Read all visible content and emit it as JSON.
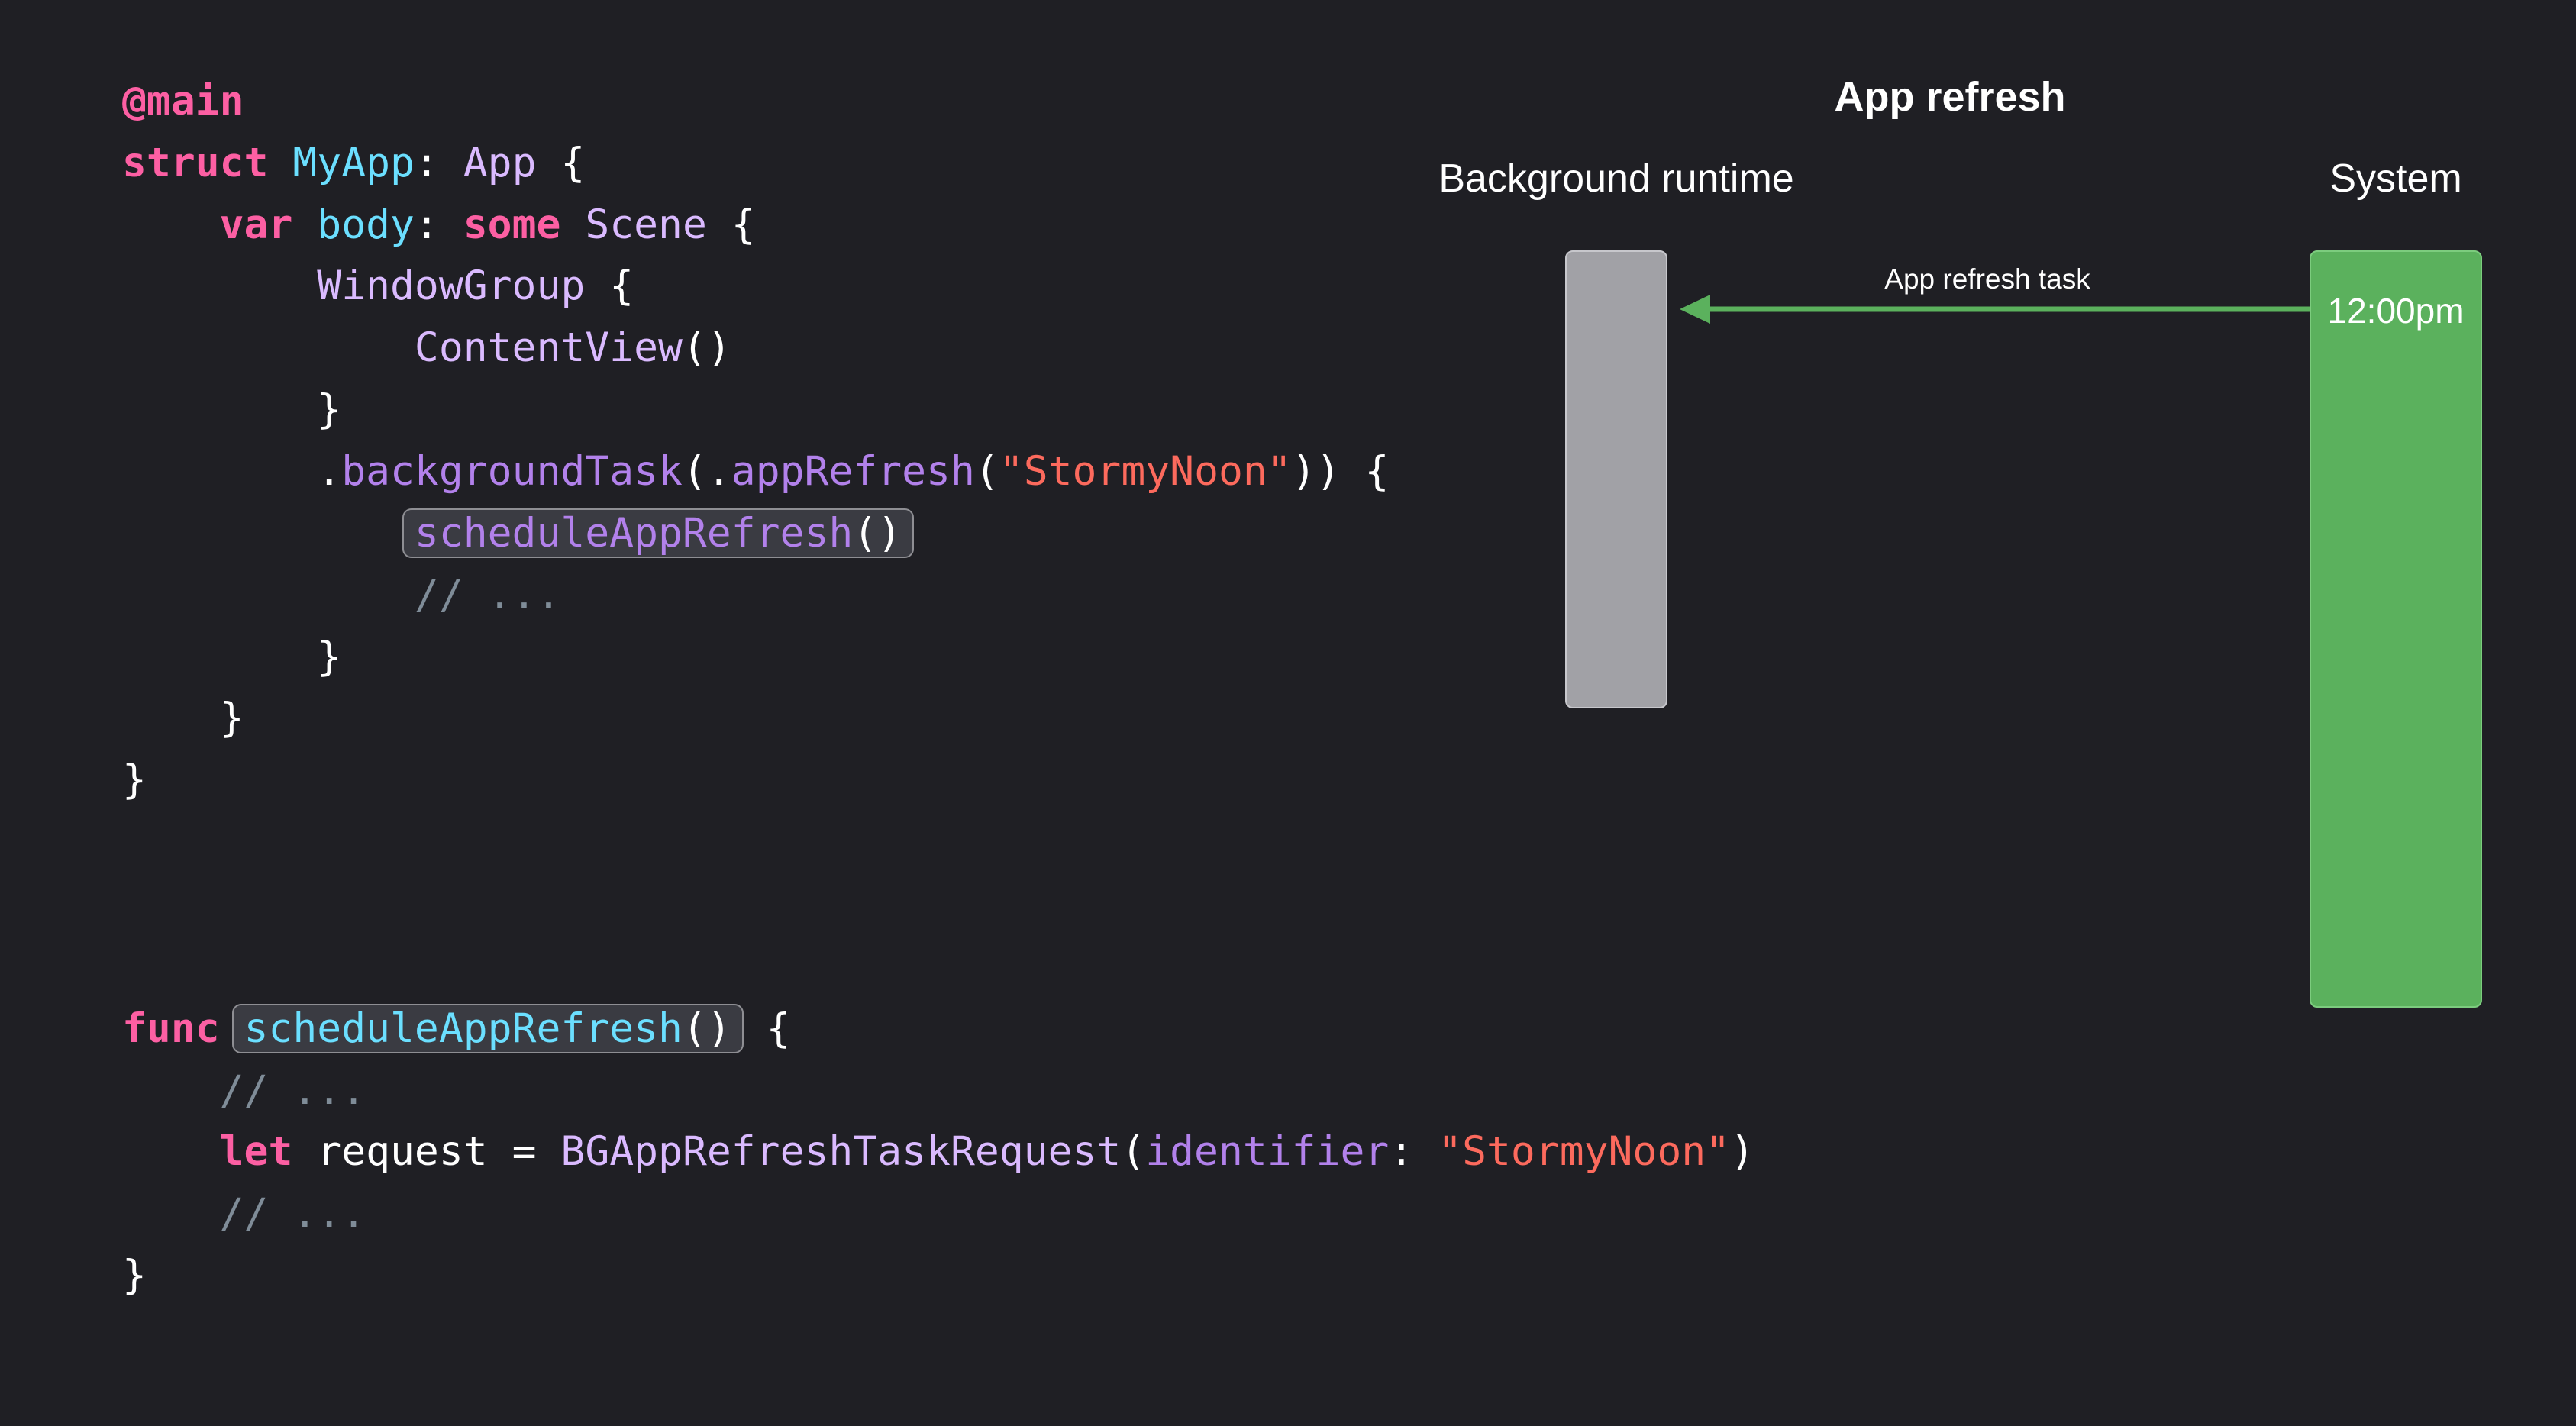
{
  "code": {
    "app_block": {
      "attribute": "@main",
      "struct_kw": "struct",
      "struct_name": "MyApp",
      "colon": ": ",
      "protocol": "App",
      "open_brace": " {",
      "var_kw": "var",
      "body_name": "body",
      "some_kw": "some",
      "scene_type": "Scene",
      "window_group": "WindowGroup",
      "content_view": "ContentView",
      "parens": "()",
      "close_brace": "}",
      "dot": ".",
      "background_task": "backgroundTask",
      "app_refresh": "appRefresh",
      "task_id_string": "\"StormyNoon\"",
      "schedule_call": "scheduleAppRefresh",
      "comment": "// ..."
    },
    "func_block": {
      "func_kw": "func",
      "func_name": "scheduleAppRefresh",
      "parens": "()",
      "open_brace": " {",
      "comment": "// ...",
      "let_kw": "let",
      "request_var": "request",
      "equals": " = ",
      "request_type": "BGAppRefreshTaskRequest",
      "identifier_label": "identifier",
      "identifier_value": "\"StormyNoon\"",
      "close_brace": "}"
    }
  },
  "diagram": {
    "title": "App refresh",
    "lanes": {
      "background_runtime": "Background runtime",
      "system": "System"
    },
    "system_time": "12:00pm",
    "arrow_label": "App refresh task",
    "colors": {
      "background_bar": "#a1a1a6",
      "system_bar": "#5bb15d",
      "arrow": "#5bb15d"
    }
  }
}
